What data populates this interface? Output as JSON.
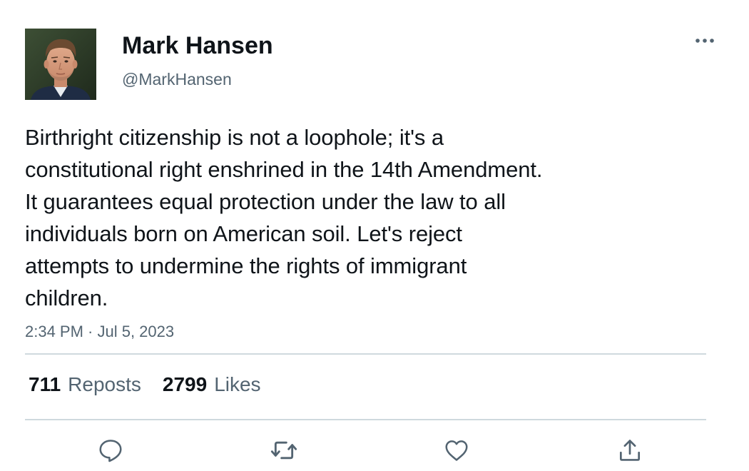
{
  "author": {
    "display_name": "Mark Hansen",
    "handle": "@MarkHansen",
    "avatar_icon": "user-avatar-photo"
  },
  "tweet": {
    "text": "Birthright citizenship is not a loophole; it's a\nconstitutional right enshrined in the 14th Amendment.\nIt guarantees equal protection under the law to all\nindividuals born on American soil. Let's reject\nattempts to undermine the rights of immigrant\nchildren.",
    "timestamp": "2:34 PM · Jul 5, 2023"
  },
  "stats": {
    "reposts_count": "711",
    "reposts_label": "Reposts",
    "likes_count": "2799",
    "likes_label": "Likes"
  },
  "actions": {
    "reply_icon": "reply-icon",
    "repost_icon": "repost-icon",
    "like_icon": "heart-icon",
    "share_icon": "share-icon",
    "more_icon": "more-options-icon"
  },
  "colors": {
    "text_primary": "#0f1419",
    "text_secondary": "#536471",
    "divider": "#cfd9de",
    "icon": "#536471"
  }
}
